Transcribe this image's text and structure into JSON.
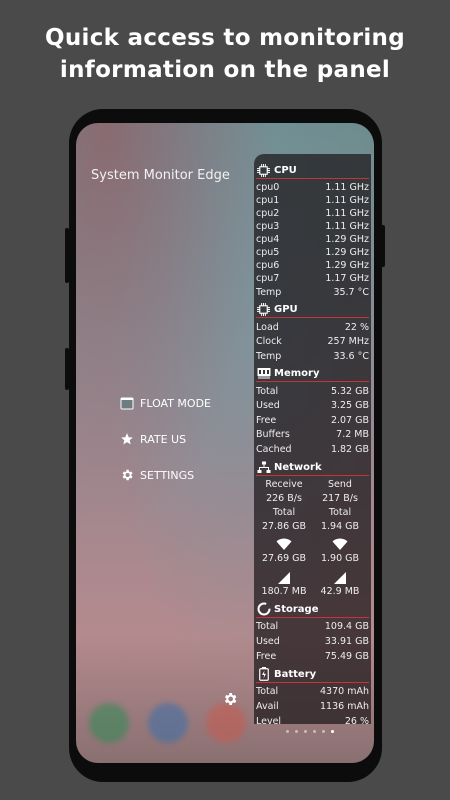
{
  "headline": {
    "line1": "Quick access to monitoring",
    "line2": "information on the panel"
  },
  "screen": {
    "app_title": "System Monitor Edge",
    "menu": [
      {
        "label": "FLOAT MODE",
        "icon": "window-icon"
      },
      {
        "label": "RATE US",
        "icon": "star-icon"
      },
      {
        "label": "SETTINGS",
        "icon": "gear-icon"
      }
    ],
    "page_indicator": {
      "count": 6,
      "active": 5
    }
  },
  "panel": {
    "cpu": {
      "title": "CPU",
      "rows": [
        {
          "label": "cpu0",
          "value": "1.11 GHz"
        },
        {
          "label": "cpu1",
          "value": "1.11 GHz"
        },
        {
          "label": "cpu2",
          "value": "1.11 GHz"
        },
        {
          "label": "cpu3",
          "value": "1.11 GHz"
        },
        {
          "label": "cpu4",
          "value": "1.29 GHz"
        },
        {
          "label": "cpu5",
          "value": "1.29 GHz"
        },
        {
          "label": "cpu6",
          "value": "1.29 GHz"
        },
        {
          "label": "cpu7",
          "value": "1.17 GHz"
        },
        {
          "label": "Temp",
          "value": "35.7 °C"
        }
      ]
    },
    "gpu": {
      "title": "GPU",
      "rows": [
        {
          "label": "Load",
          "value": "22 %"
        },
        {
          "label": "Clock",
          "value": "257 MHz"
        },
        {
          "label": "Temp",
          "value": "33.6 °C"
        }
      ]
    },
    "memory": {
      "title": "Memory",
      "rows": [
        {
          "label": "Total",
          "value": "5.32 GB"
        },
        {
          "label": "Used",
          "value": "3.25 GB"
        },
        {
          "label": "Free",
          "value": "2.07 GB"
        },
        {
          "label": "Buffers",
          "value": "7.2 MB"
        },
        {
          "label": "Cached",
          "value": "1.82 GB"
        }
      ]
    },
    "network": {
      "title": "Network",
      "receive_label": "Receive",
      "send_label": "Send",
      "receive_rate": "226 B/s",
      "send_rate": "217 B/s",
      "total_label": "Total",
      "receive_total": "27.86 GB",
      "send_total": "1.94 GB",
      "wifi_receive": "27.69 GB",
      "wifi_send": "1.90 GB",
      "mobile_receive": "180.7 MB",
      "mobile_send": "42.9 MB"
    },
    "storage": {
      "title": "Storage",
      "rows": [
        {
          "label": "Total",
          "value": "109.4 GB"
        },
        {
          "label": "Used",
          "value": "33.91 GB"
        },
        {
          "label": "Free",
          "value": "75.49 GB"
        }
      ]
    },
    "battery": {
      "title": "Battery",
      "rows": [
        {
          "label": "Total",
          "value": "4370 mAh"
        },
        {
          "label": "Avail",
          "value": "1136 mAh"
        },
        {
          "label": "Level",
          "value": "26 %"
        }
      ]
    }
  },
  "colors": {
    "accent_line": "#c8333a",
    "panel_bg": "#1c181a",
    "background": "#4a4a4a"
  }
}
